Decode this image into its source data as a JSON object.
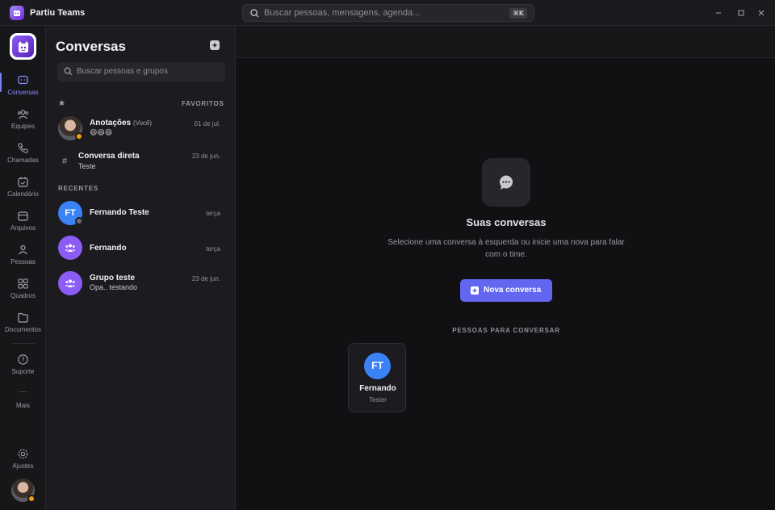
{
  "app": {
    "title": "Partiu Teams",
    "global_search_placeholder": "Buscar pessoas, mensagens, agenda...",
    "global_search_shortcut": "⌘K"
  },
  "rail": {
    "items": [
      {
        "label": "Conversas",
        "icon": "chat-icon",
        "active": true
      },
      {
        "label": "Equipes",
        "icon": "team-icon"
      },
      {
        "label": "Chamadas",
        "icon": "phone-icon"
      },
      {
        "label": "Calendário",
        "icon": "calendar-icon"
      },
      {
        "label": "Arquivos",
        "icon": "folder-icon"
      },
      {
        "label": "Pessoas",
        "icon": "people-icon"
      },
      {
        "label": "Quadros",
        "icon": "grid-icon"
      },
      {
        "label": "Documentos",
        "icon": "document-icon"
      }
    ],
    "support_label": "Suporte",
    "more_label": "Mais",
    "more_glyph": "···",
    "settings_label": "Ajustes",
    "accent_color": "#7c7ff5"
  },
  "panel": {
    "title": "Conversas",
    "search_placeholder": "Buscar pessoas e grupos",
    "favorites_label": "FAVORITOS",
    "recent_label": "RECENTES",
    "favorites": [
      {
        "name": "Anotações",
        "tag": "(Você)",
        "sub": "😄😄😄",
        "date": "01 de jul.",
        "avatar": "photo"
      },
      {
        "name": "Conversa direta",
        "sub": "Teste",
        "date": "23 de jun.",
        "avatar": "hash",
        "avatar_glyph": "#"
      }
    ],
    "recent": [
      {
        "name": "Fernando Teste",
        "initials": "FT",
        "date": "terça",
        "avatar": "initials"
      },
      {
        "name": "Fernando",
        "date": "terça",
        "avatar": "group"
      },
      {
        "name": "Grupo teste",
        "sub": "Opa.. testando",
        "date": "23 de jun.",
        "avatar": "group"
      }
    ]
  },
  "main": {
    "empty_title": "Suas conversas",
    "empty_description": "Selecione uma conversa à esquerda ou inicie uma nova para falar com o time.",
    "new_conversation_label": "Nova conversa",
    "people_section_label": "PESSOAS PARA CONVERSAR",
    "people": [
      {
        "initials": "FT",
        "name": "Fernando",
        "role": "Tester"
      }
    ]
  },
  "colors": {
    "primary_button": "#6366f1",
    "avatar_blue": "#3b82f6",
    "avatar_purple": "#8b5cf6",
    "status_orange": "#f59e0b"
  }
}
